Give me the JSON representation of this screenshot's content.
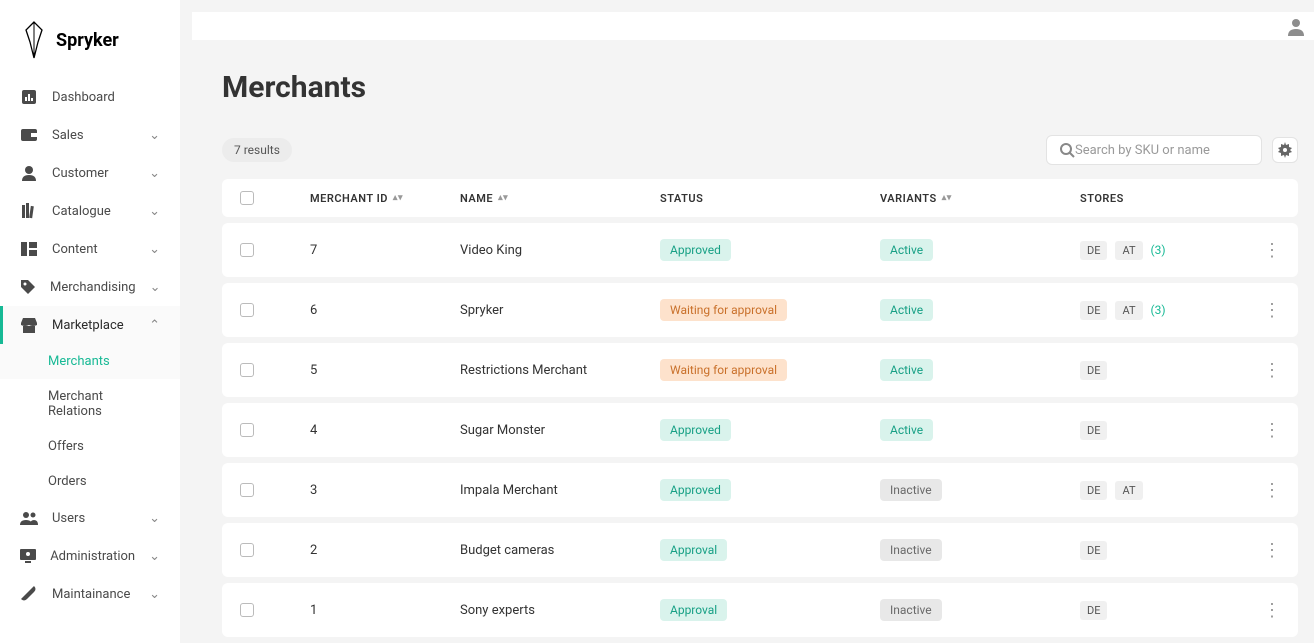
{
  "brand": "Spryker",
  "nav": {
    "dashboard": "Dashboard",
    "sales": "Sales",
    "customer": "Customer",
    "catalogue": "Catalogue",
    "content": "Content",
    "merchandising": "Merchandising",
    "marketplace": "Marketplace",
    "users": "Users",
    "administration": "Administration",
    "maintainance": "Maintainance",
    "sub": {
      "merchants": "Merchants",
      "merchant_relations": "Merchant Relations",
      "offers": "Offers",
      "orders": "Orders"
    }
  },
  "page": {
    "title": "Merchants",
    "results": "7 results"
  },
  "search": {
    "placeholder": "Search by SKU or name"
  },
  "columns": {
    "merchant_id": "MERCHANT ID",
    "name": "NAME",
    "status": "STATUS",
    "variants": "VARIANTS",
    "stores": "STORES"
  },
  "status_labels": {
    "approved": "Approved",
    "waiting": "Waiting for approval",
    "approval": "Approval"
  },
  "variant_labels": {
    "active": "Active",
    "inactive": "Inactive"
  },
  "store_codes": {
    "de": "DE",
    "at": "AT"
  },
  "more3": "(3)",
  "rows": [
    {
      "id": "7",
      "name": "Video King",
      "status": "approved",
      "variant": "active",
      "stores": [
        "de",
        "at"
      ],
      "more": true
    },
    {
      "id": "6",
      "name": "Spryker",
      "status": "waiting",
      "variant": "active",
      "stores": [
        "de",
        "at"
      ],
      "more": true
    },
    {
      "id": "5",
      "name": "Restrictions Merchant",
      "status": "waiting",
      "variant": "active",
      "stores": [
        "de"
      ],
      "more": false
    },
    {
      "id": "4",
      "name": "Sugar Monster",
      "status": "approved",
      "variant": "active",
      "stores": [
        "de"
      ],
      "more": false
    },
    {
      "id": "3",
      "name": "Impala Merchant",
      "status": "approved",
      "variant": "inactive",
      "stores": [
        "de",
        "at"
      ],
      "more": false
    },
    {
      "id": "2",
      "name": "Budget cameras",
      "status": "approval",
      "variant": "inactive",
      "stores": [
        "de"
      ],
      "more": false
    },
    {
      "id": "1",
      "name": "Sony experts",
      "status": "approval",
      "variant": "inactive",
      "stores": [
        "de"
      ],
      "more": false
    }
  ]
}
